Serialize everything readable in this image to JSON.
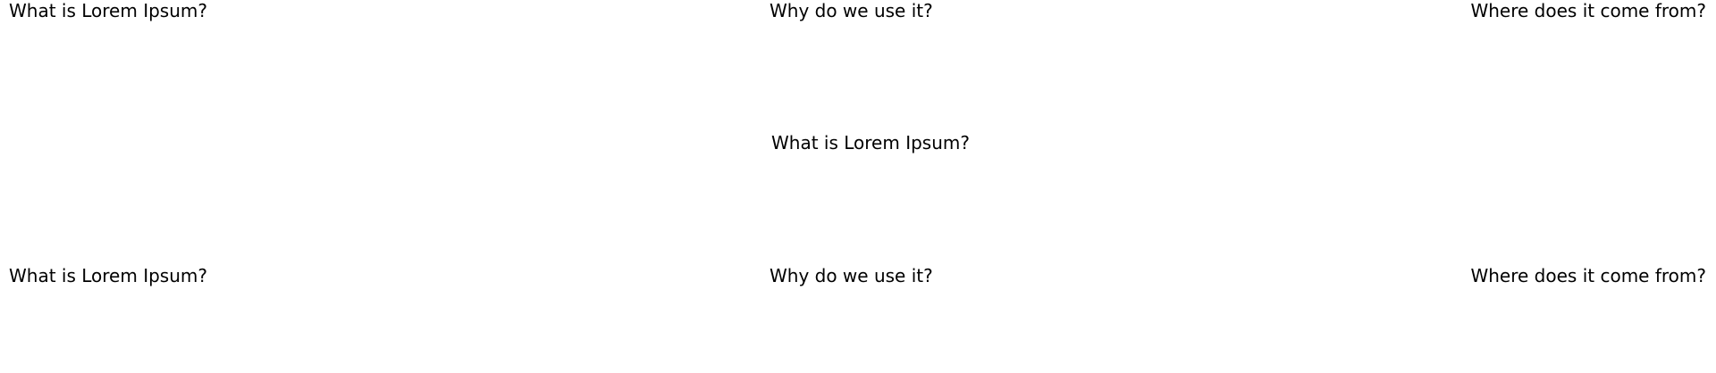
{
  "rows": [
    {
      "items": [
        {
          "text": "What is Lorem Ipsum?"
        },
        {
          "text": "Why do we use it?"
        },
        {
          "text": "Where does it come from?"
        }
      ]
    },
    {
      "items": [
        {
          "text": "What is Lorem Ipsum?"
        }
      ]
    },
    {
      "items": [
        {
          "text": "What is Lorem Ipsum?"
        },
        {
          "text": "Why do we use it?"
        },
        {
          "text": "Where does it come from?"
        }
      ]
    }
  ]
}
